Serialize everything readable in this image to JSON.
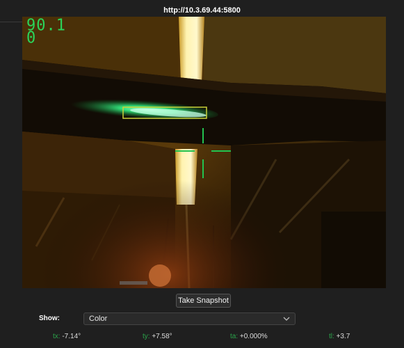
{
  "browser": {
    "url": "http://10.3.69.44:5800"
  },
  "video": {
    "osd_line1": "90.1",
    "osd_line2": "0"
  },
  "controls": {
    "snapshot_label": "Take Snapshot",
    "show_label": "Show:",
    "show_selected": "Color"
  },
  "readouts": [
    {
      "key": "tx:",
      "value": "-7.14°"
    },
    {
      "key": "ty:",
      "value": "+7.58°"
    },
    {
      "key": "ta:",
      "value": "+0.000%"
    },
    {
      "key": "tl:",
      "value": "+3.7"
    }
  ],
  "colors": {
    "osd_green": "#2bd45a",
    "target_box": "#c9d23a",
    "crosshair": "#23c24f",
    "readout_key": "#2aa34a",
    "background": "#1f1f1f"
  },
  "icons": {
    "dropdown": "chevron-down-icon",
    "crosshair": "crosshair-icon",
    "target": "target-box"
  }
}
